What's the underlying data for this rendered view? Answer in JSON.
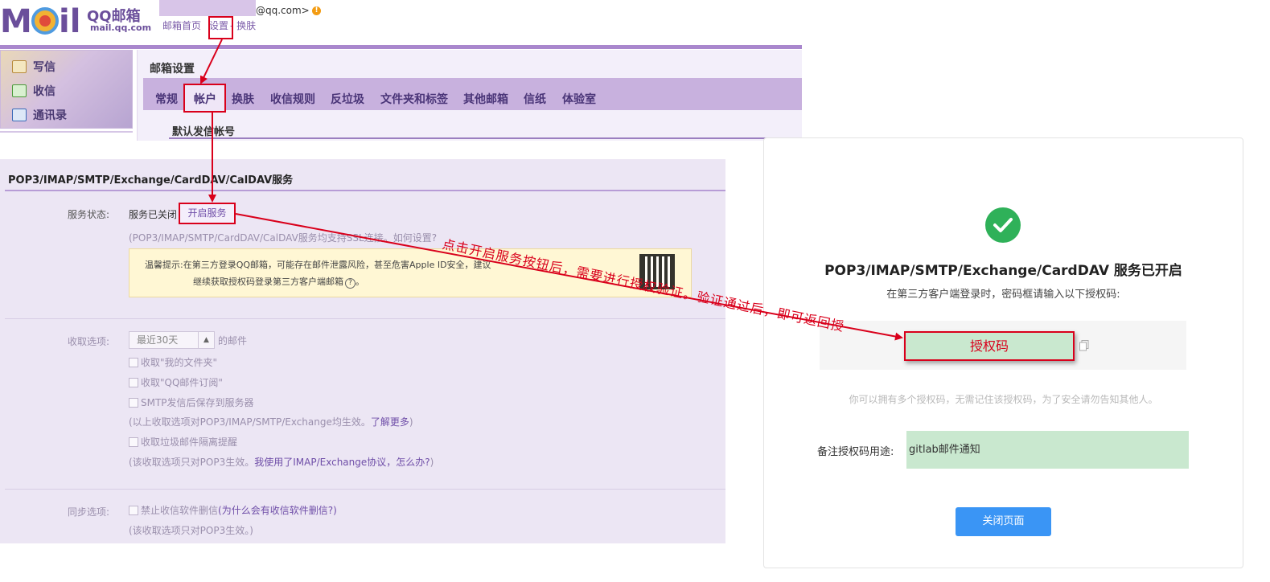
{
  "header": {
    "logo_text": "M  il",
    "logo_qq": "QQ邮箱",
    "logo_domain": "mail.qq.com",
    "user_email": "@qq.com>",
    "top_links": [
      "邮箱首页",
      "设置",
      "- 换肤"
    ]
  },
  "left_nav": {
    "items": [
      {
        "label": "写信",
        "icon": "write-icon"
      },
      {
        "label": "收信",
        "icon": "inbox-icon"
      },
      {
        "label": "通讯录",
        "icon": "contacts-icon"
      }
    ]
  },
  "settings": {
    "title": "邮箱设置",
    "tabs": [
      "常规",
      "帐户",
      "换肤",
      "收信规则",
      "反垃圾",
      "文件夹和标签",
      "其他邮箱",
      "信纸",
      "体验室"
    ],
    "active_tab": "帐户",
    "section_title": "默认发信帐号"
  },
  "pop_panel": {
    "title": "POP3/IMAP/SMTP/Exchange/CardDAV/CalDAV服务",
    "service_status_label": "服务状态:",
    "service_status_value": "服务已关闭",
    "enable_button": "开启服务",
    "ssl_note": "(POP3/IMAP/SMTP/CardDAV/CalDAV服务均支持SSL连接。如何设置?",
    "tip_line1": "温馨提示:在第三方登录QQ邮箱，可能存在邮件泄露风险，甚至危害Apple ID安全，建议",
    "tip_line2": "继续获取授权码登录第三方客户端邮箱",
    "receive_label": "收取选项:",
    "receive_select": "最近30天",
    "receive_suffix": "的邮件",
    "checkboxes": [
      "收取\"我的文件夹\"",
      "收取\"QQ邮件订阅\"",
      "SMTP发信后保存到服务器"
    ],
    "note1": "(以上收取选项对POP3/IMAP/SMTP/Exchange均生效。了解更多)",
    "note1_plain": "(以上收取选项对POP3/IMAP/SMTP/Exchange均生效。",
    "note1_link": "了解更多",
    "note1_close": ")",
    "spam_checkbox": "收取垃圾邮件隔离提醒",
    "note2_plain": "(该收取选项只对POP3生效。",
    "note2_link": "我使用了IMAP/Exchange协议，怎么办?",
    "note2_close": ")",
    "sync_label": "同步选项:",
    "sync_checkbox": "禁止收信软件删信",
    "sync_link": "(为什么会有收信软件删信?)",
    "note3": "(该收取选项只对POP3生效。)"
  },
  "annotation": "点击开启服务按钮后，需要进行授权验证。验证通过后，即可返回授",
  "card": {
    "title": "POP3/IMAP/SMTP/Exchange/CardDAV 服务已开启",
    "subtitle": "在第三方客户端登录时，密码框请输入以下授权码:",
    "auth_code": "授权码",
    "note": "你可以拥有多个授权码，无需记住该授权码，为了安全请勿告知其他人。",
    "remark_label": "备注授权码用途:",
    "remark_value": "gitlab邮件通知",
    "close_button": "关闭页面"
  },
  "colors": {
    "accent_purple": "#a987cd",
    "annotation_red": "#d9001b",
    "success_green": "#2fb159",
    "button_blue": "#3a95f5"
  }
}
